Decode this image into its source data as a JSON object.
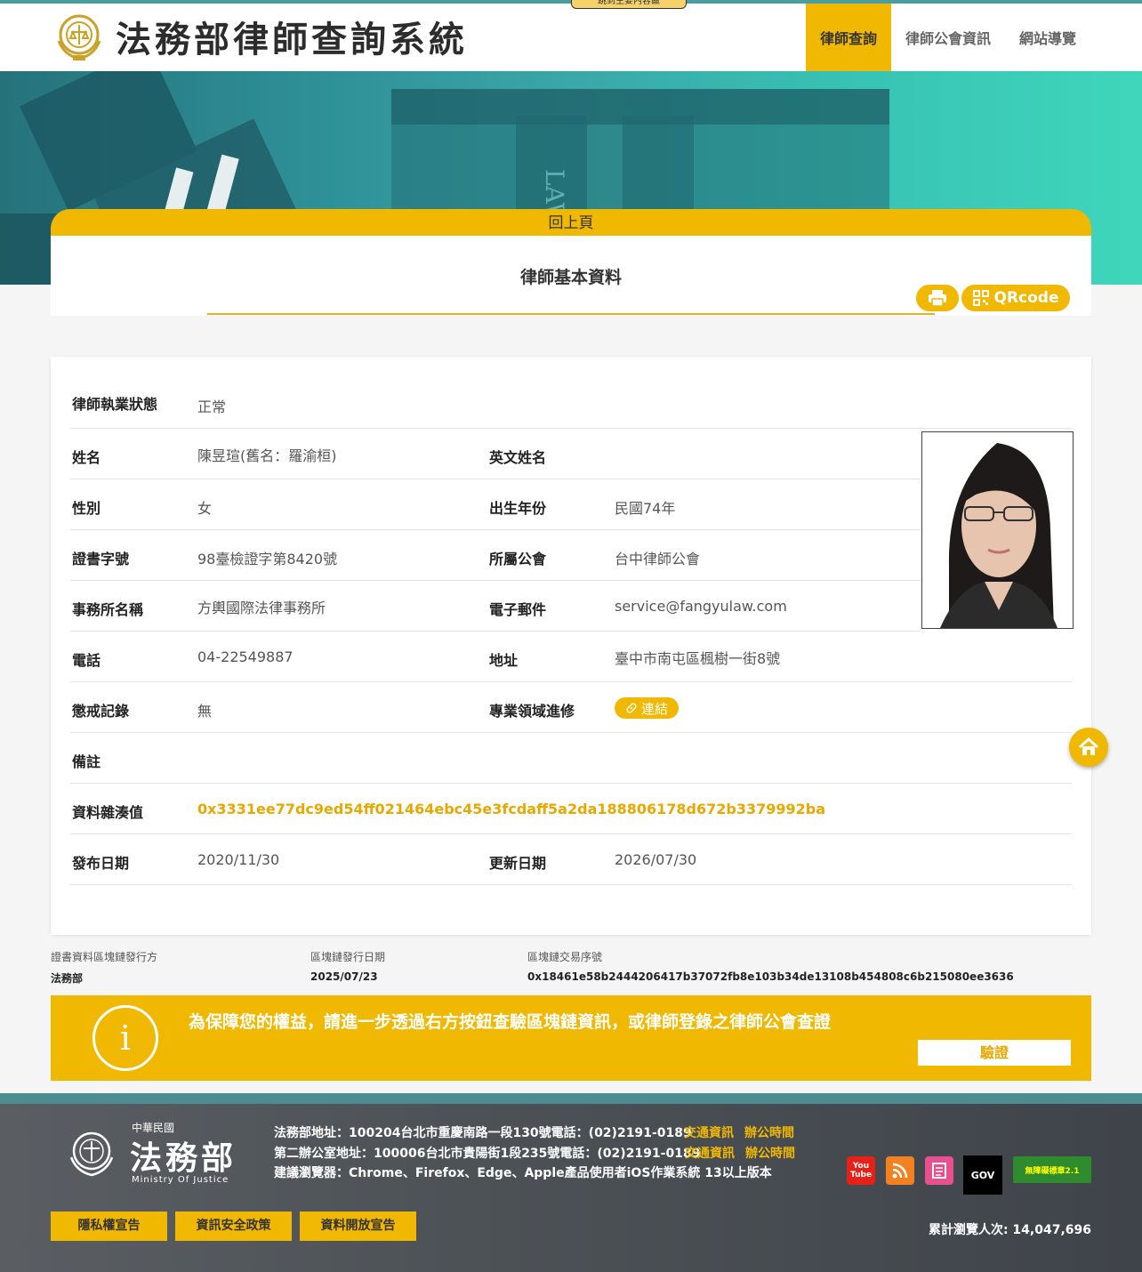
{
  "skip_link": "跳到主要內容區",
  "header": {
    "site_title": "法務部律師查詢系統",
    "nav": [
      "律師查詢",
      "律師公會資訊",
      "網站導覽"
    ],
    "active_nav": 0
  },
  "card": {
    "back_label": "回上頁",
    "title": "律師基本資料",
    "qr_label": "QRcode"
  },
  "profile": {
    "status_label": "律師執業狀態",
    "status_value": "正常",
    "name_label": "姓名",
    "name_value": "陳昱瑄(舊名：羅渝桓)",
    "en_name_label": "英文姓名",
    "en_name_value": "",
    "gender_label": "性別",
    "gender_value": "女",
    "birth_label": "出生年份",
    "birth_value": "民國74年",
    "cert_label": "證書字號",
    "cert_value": "98臺檢證字第8420號",
    "bar_label": "所屬公會",
    "bar_value": "台中律師公會",
    "firm_label": "事務所名稱",
    "firm_value": "方輿國際法律事務所",
    "email_label": "電子郵件",
    "email_value": "service@fangyulaw.com",
    "phone_label": "電話",
    "phone_value": "04-22549887",
    "address_label": "地址",
    "address_value": "臺中市南屯區楓樹一街8號",
    "discipline_label": "懲戒記錄",
    "discipline_value": "無",
    "training_label": "專業領域進修",
    "training_link": "連結",
    "note_label": "備註",
    "note_value": "",
    "hash_label": "資料雜湊值",
    "hash_value": "0x3331ee77dc9ed54ff021464ebc45e3fcdaff5a2da188806178d672b3379992ba",
    "publish_label": "發布日期",
    "publish_value": "2020/11/30",
    "update_label": "更新日期",
    "update_value": "2026/07/30"
  },
  "blockchain": {
    "issuer_label": "證書資料區塊鏈發行方",
    "issuer_value": "法務部",
    "date_label": "區塊鏈發行日期",
    "date_value": "2025/07/23",
    "tx_label": "區塊鏈交易序號",
    "tx_value": "0x18461e58b2444206417b37072fb8e103b34de13108b454808c6b215080ee3636"
  },
  "verify": {
    "icon": "info-icon",
    "message": "為保障您的權益，請進一步透過右方按鈕查驗區塊鏈資訊，或律師登錄之律師公會查證",
    "button": "驗證"
  },
  "footer": {
    "logo_small": "中華民國",
    "logo_big": "法務部",
    "logo_en": "Ministry Of Justice",
    "line1": "法務部地址：100204台北市重慶南路一段130號電話：(02)2191-0189",
    "line2": "第二辦公室地址：100006台北市貴陽街1段235號電話：(02)2191-0189",
    "line3": "建議瀏覽器：Chrome、Firefox、Edge、Apple產品使用者iOS作業系統 13以上版本",
    "traffic": "交通資訊",
    "hours": "辦公時間",
    "buttons": [
      "隱私權宣告",
      "資訊安全政策",
      "資料開放宣告"
    ],
    "icons": [
      "youtube-icon",
      "rss-icon",
      "news-icon",
      "gov-icon",
      "accessibility-badge-icon"
    ],
    "accessibility_text": "無障礙標章2.1",
    "youtube_text": "You Tube",
    "gov_text": "GOV",
    "counter": "累計瀏覽人次: 14,047,696"
  },
  "colors": {
    "accent": "#f0b800",
    "teal": "#3aa7a8",
    "footer": "#4d5257"
  }
}
